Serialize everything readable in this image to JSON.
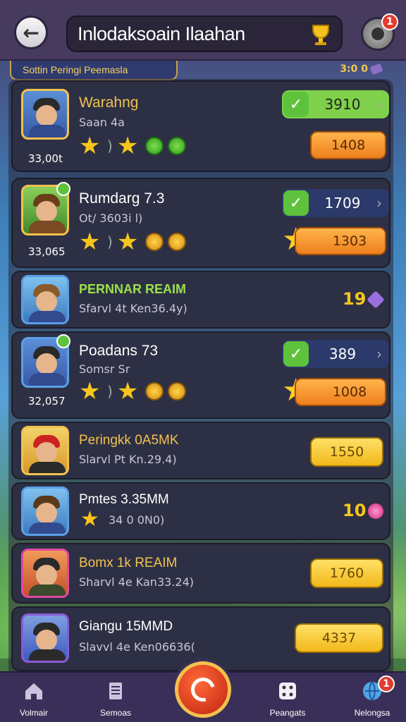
{
  "header": {
    "back_icon": "arrow-left-icon",
    "title": "Inlodaksoain Ilaahan",
    "title_icon": "trophy-icon",
    "settings_icon": "gear-icon",
    "settings_badge": "1"
  },
  "subheader": {
    "label": "Sottin Peringi Peemasla",
    "coins": "3:0 0"
  },
  "rows": [
    {
      "name": "Warahng",
      "sub": "Saan 4a",
      "score": "33,00t",
      "check_value": "3910",
      "orange_value": "1408"
    },
    {
      "name": "Rumdarg 7.3",
      "sub": "Ot/ 3603i l)",
      "score": "33,065",
      "check_value": "1709",
      "orange_value": "1303"
    },
    {
      "name": "PERNNAR REAIM",
      "sub": "Sfarvl 4t Ken36.4y)",
      "right_value": "19"
    },
    {
      "name": "Poadans 73",
      "sub": "Somsr Sr",
      "score": "32,057",
      "check_value": "389",
      "orange_value": "1008"
    },
    {
      "name": "Peringkk 0A5MK",
      "sub": "Slarvl Pt Kn.29.4)",
      "yellow_value": "1550"
    },
    {
      "name": "Pmtes 3.35MM",
      "sub": "34 0 0N0)",
      "right_value": "10"
    },
    {
      "name": "Bomx 1k REAIM",
      "sub": "Sharvl 4e Kan33.24)",
      "yellow_value": "1760"
    },
    {
      "name": "Giangu 15MMD",
      "sub": "Slavvl 4e Ken06636(",
      "yellow_value": "4337"
    }
  ],
  "nav": [
    {
      "label": "Volmair",
      "icon": "home-icon"
    },
    {
      "label": "Semoas",
      "icon": "document-icon"
    },
    {
      "label": "",
      "icon": "play-center-icon"
    },
    {
      "label": "Peangats",
      "icon": "dice-icon"
    },
    {
      "label": "Nelongsa",
      "icon": "globe-chat-icon",
      "badge": "1"
    }
  ]
}
